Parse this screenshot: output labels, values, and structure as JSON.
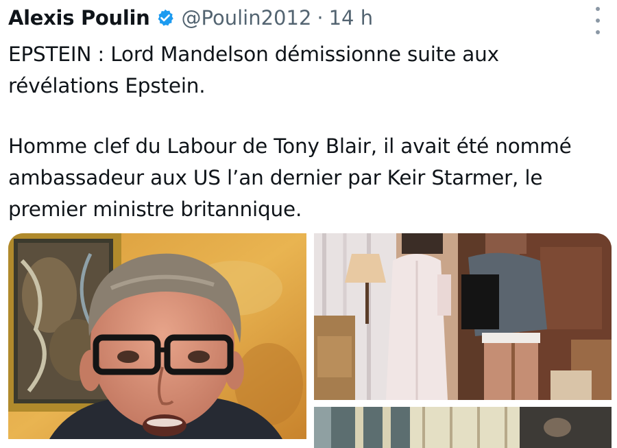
{
  "tweet": {
    "author_name": "Alexis Poulin",
    "handle": "@Poulin2012",
    "separator": "·",
    "time": "14 h",
    "paragraph_1": "EPSTEIN : Lord Mandelson démissionne suite aux révélations Epstein.",
    "paragraph_2": "Homme clef du Labour de Tony Blair, il avait été nommé ambassadeur aux US l’an dernier par Keir Starmer, le premier ministre britannique."
  },
  "icons": {
    "verified": "verified-badge-icon",
    "more": "more-vertical-icon"
  },
  "colors": {
    "verified": "#1d9bf0",
    "secondary_text": "#536471",
    "text": "#0f1419"
  }
}
